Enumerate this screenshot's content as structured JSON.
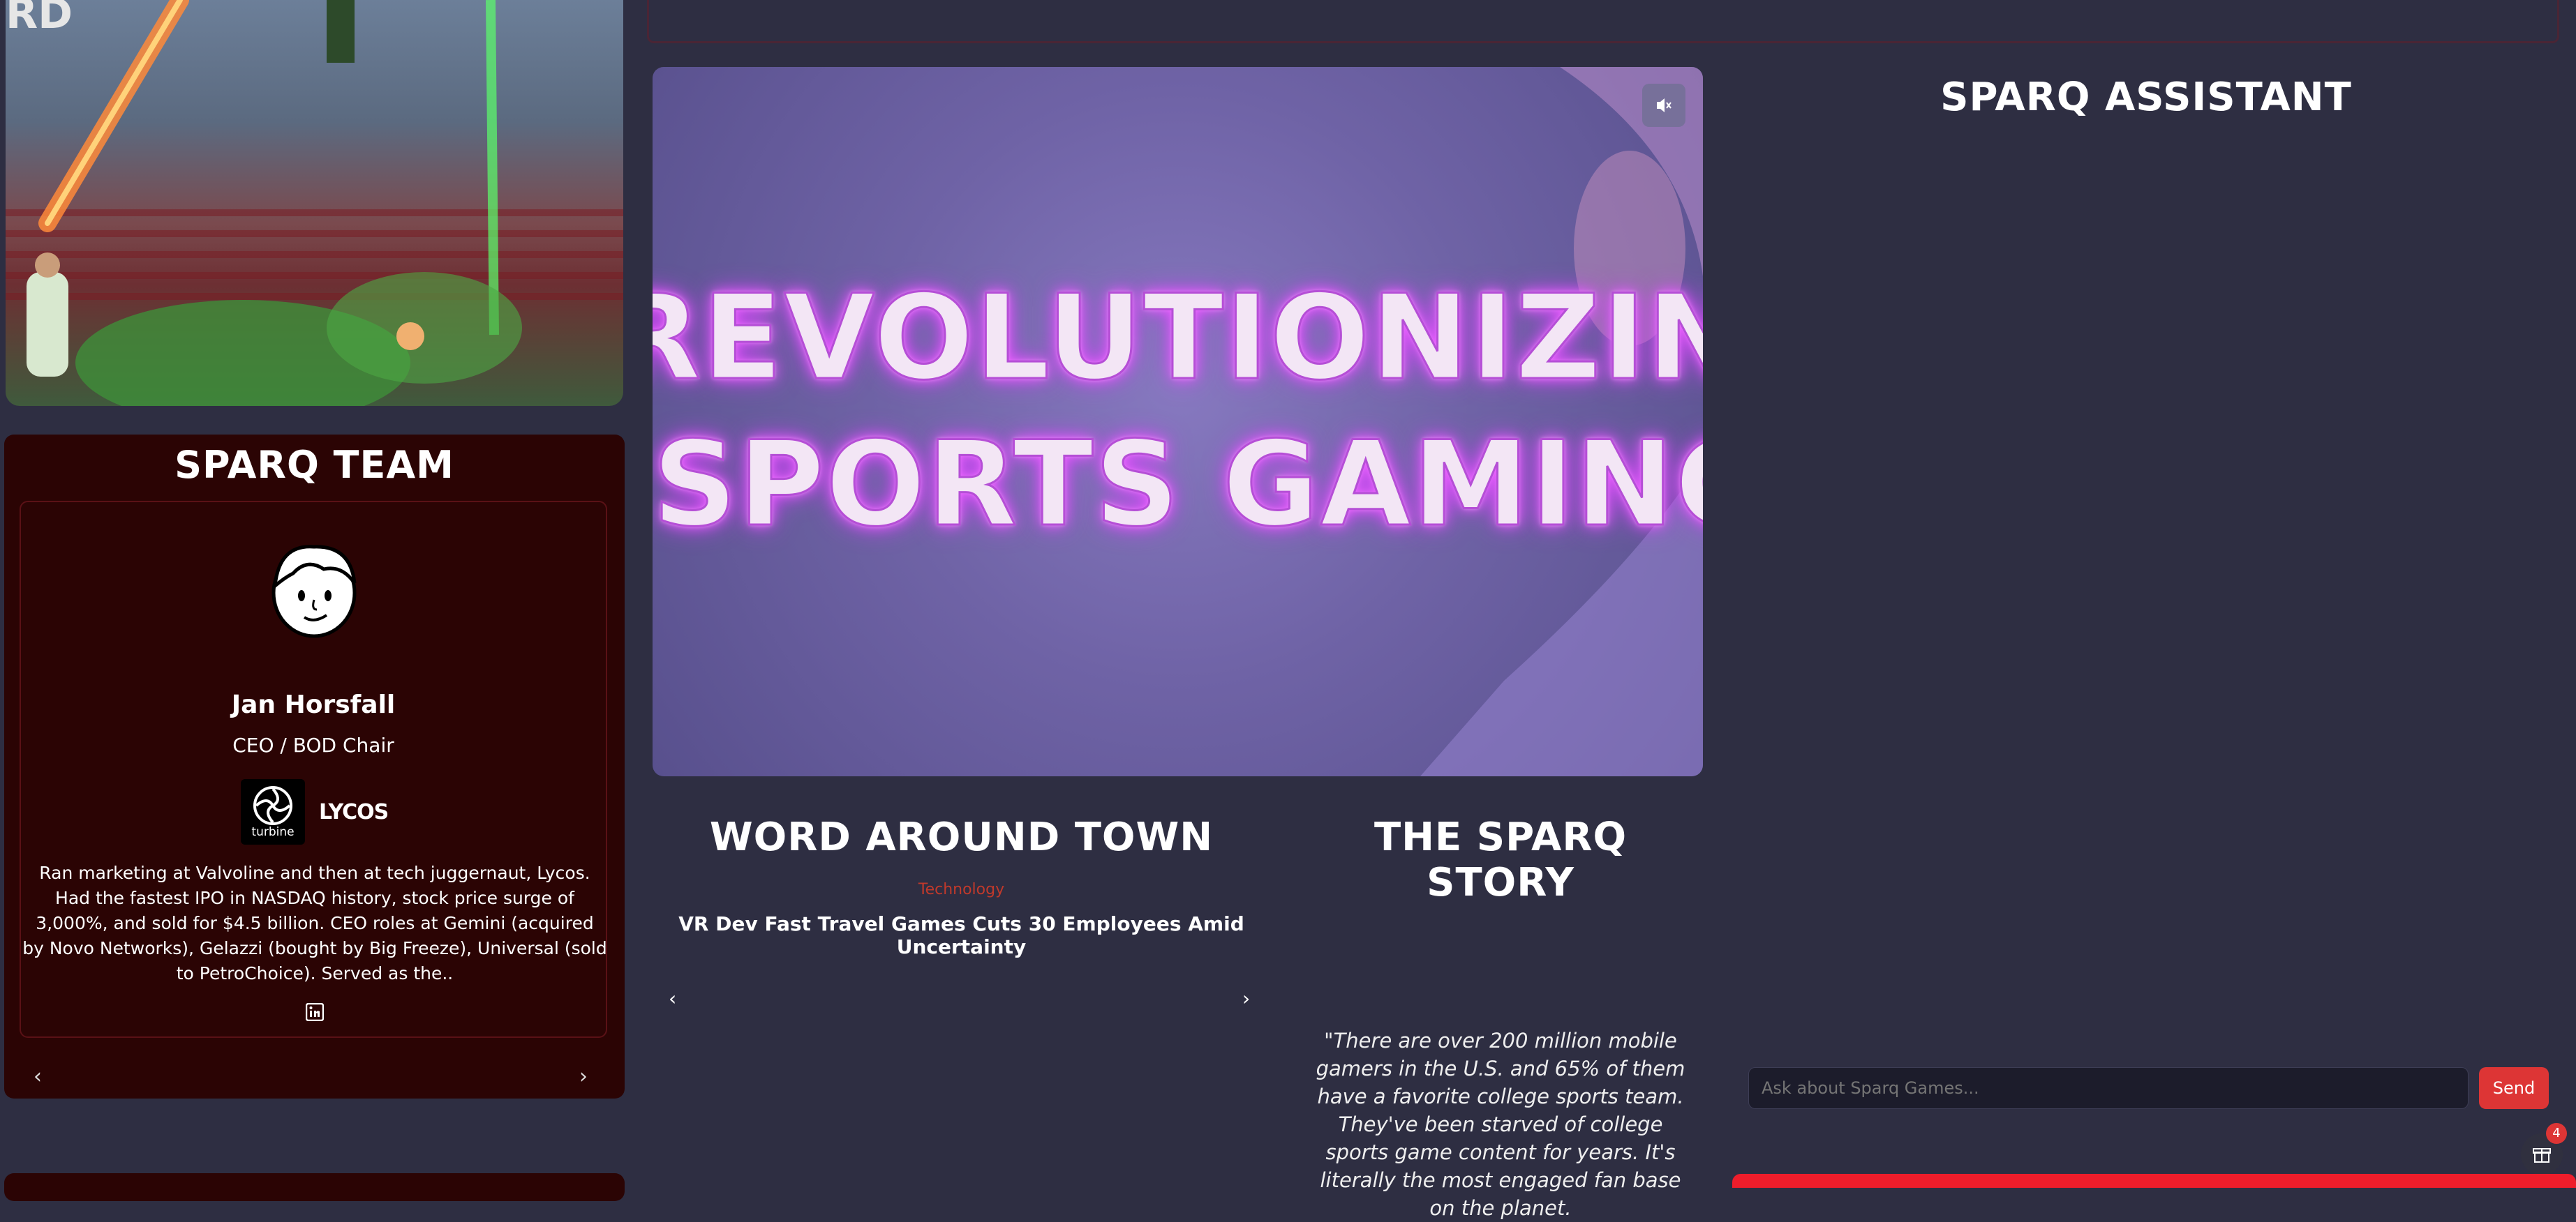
{
  "team": {
    "title": "SPARQ TEAM",
    "member": {
      "name": "Jan Horsfall",
      "role": "CEO / BOD Chair",
      "bio": "Ran marketing at Valvoline and then at tech juggernaut, Lycos. Had the fastest IPO in NASDAQ history, stock price surge of 3,000%, and sold for $4.5 billion. CEO roles at Gemini (acquired by Novo Networks), Gelazzi (bought by Big Freeze), Universal (sold to PetroChoice). Served as the..",
      "logos": {
        "turbine": "turbine",
        "lycos": "LYCOS"
      }
    },
    "prev_label": "‹",
    "next_label": "›"
  },
  "video": {
    "headline_line1": "REVOLUTIONIZING MOBILE",
    "headline_line2": "SPORTS GAMING",
    "mute_icon": "volume-mute-icon"
  },
  "news": {
    "title": "WORD AROUND TOWN",
    "category": "Technology",
    "headline": "VR Dev Fast Travel Games Cuts 30 Employees Amid Uncertainty",
    "prev_label": "‹",
    "next_label": "›"
  },
  "story": {
    "title": "THE SPARQ STORY",
    "quote": "\"There are over 200 million mobile gamers in the U.S. and 65% of them have a favorite college sports team. They've been starved of college sports game content for years. It's literally the most engaged fan base on the planet."
  },
  "assistant": {
    "title": "SPARQ ASSISTANT",
    "input_placeholder": "Ask about Sparq Games...",
    "send_label": "Send",
    "notification_count": "4"
  },
  "colors": {
    "background": "#2e2e42",
    "team_card": "#2b0404",
    "accent_red": "#dd3535",
    "category_red": "#c0392b"
  }
}
